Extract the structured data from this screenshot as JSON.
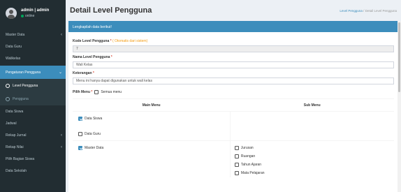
{
  "user": {
    "name": "admin | admin",
    "status": "online"
  },
  "sidebar": {
    "items": [
      {
        "label": "Master Data",
        "chevron": "‹"
      },
      {
        "label": "Data Guru",
        "chevron": ""
      },
      {
        "label": "Walikelas",
        "chevron": ""
      },
      {
        "label": "Pengaturan Pengguna",
        "chevron": "⌄"
      },
      {
        "label": "Level Pengguna"
      },
      {
        "label": "Pengguna"
      },
      {
        "label": "Data Siswa",
        "chevron": ""
      },
      {
        "label": "Jadwal",
        "chevron": ""
      },
      {
        "label": "Rekap Jurnal",
        "chevron": "‹"
      },
      {
        "label": "Rekap Nilai",
        "chevron": "‹"
      },
      {
        "label": "Pilih Bagian Siswa",
        "chevron": ""
      },
      {
        "label": "Data Sekolah",
        "chevron": ""
      }
    ]
  },
  "header": {
    "title": "Detail Level Pengguna",
    "breadcrumb": {
      "link": "Level Pengguna",
      "separator": "/",
      "current": "Detail Level Pengguna"
    }
  },
  "form": {
    "box_title": "Lengkapilah data berikut!",
    "kode_label": "Kode Level Pengguna",
    "kode_hint": "( Otomatis dari sistem)",
    "kode_value": "7",
    "nama_label": "Nama Level Pengguna",
    "nama_value": "Wali Kelas",
    "ket_label": "Keterangan",
    "ket_value": "Menu ini hanya dapat digunakan untuk wali kelas",
    "pilih_label": "Pilih Menu",
    "semua_label": "Semua menu",
    "required_mark": "*"
  },
  "table": {
    "col_main": "Main Menu",
    "col_sub": "Sub Menu",
    "rows": [
      {
        "main": "Data Siswa",
        "main_checked": true
      },
      {
        "main": "Data Guru",
        "main_checked": false
      },
      {
        "main": "Master Data",
        "main_checked": true,
        "subs": [
          {
            "label": "Jurusan",
            "checked": false
          },
          {
            "label": "Ruangan",
            "checked": false
          },
          {
            "label": "Tahun Ajaran",
            "checked": false
          },
          {
            "label": "Mata Pelajaran",
            "checked": false
          }
        ]
      }
    ]
  },
  "colors": {
    "accent": "#3c8dbc",
    "sidebar": "#222d32",
    "required": "#dd4b39",
    "hint": "#f39c12"
  }
}
